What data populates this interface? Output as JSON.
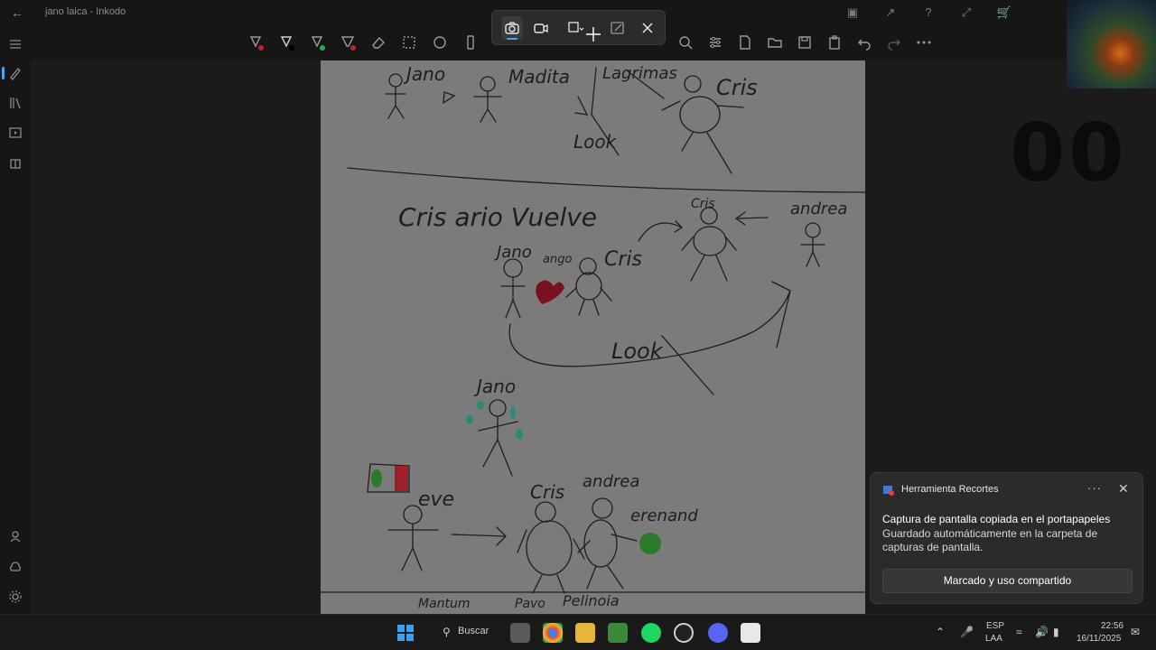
{
  "window": {
    "title": "jano laica - Inkodo"
  },
  "snipping_toolbar": {
    "modes": [
      "screenshot",
      "video",
      "snip-shape",
      "freeform",
      "close"
    ]
  },
  "counter": "00",
  "toast": {
    "app_name": "Herramienta Recortes",
    "title": "Captura de pantalla copiada en el portapapeles",
    "body": "Guardado automáticamente en la carpeta de capturas de pantalla.",
    "button": "Marcado y uso compartido"
  },
  "taskbar": {
    "search_label": "Buscar",
    "language_top": "ESP",
    "language_bottom": "LAA",
    "time": "22:56",
    "date": "16/11/2025"
  },
  "drawing_text": {
    "jano_top": "Jano",
    "madita": "Madita",
    "lagrimas": "Lagrimas",
    "cris_top": "Cris",
    "look_top": "Look",
    "cris_vuelve": "Cris ario Vuelve",
    "cris_mid": "Cris",
    "andrea_mid": "andrea",
    "jano_mid": "Jano",
    "ango": "ango",
    "cris_mid2": "Cris",
    "look_mid": "Look",
    "jano_low": "Jano",
    "eve": "eve",
    "cris_low": "Cris",
    "andrea_low": "andrea",
    "erenand": "erenand",
    "bottom_1": "Mantum",
    "bottom_2": "Pavo",
    "bottom_3": "Pelinoia"
  }
}
